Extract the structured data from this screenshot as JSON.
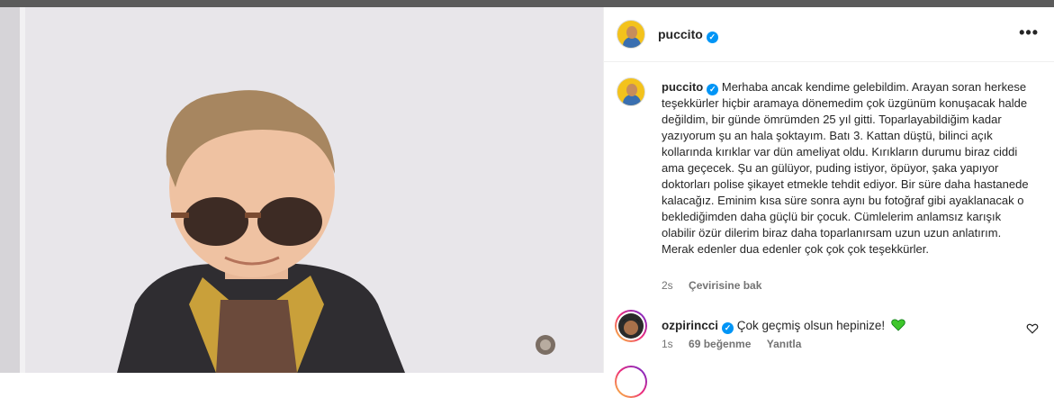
{
  "post": {
    "username": "puccito",
    "more_label": "•••"
  },
  "caption": {
    "username": "puccito",
    "text": "Merhaba ancak kendime gelebildim. Arayan soran herkese teşekkürler hiçbir aramaya dönemedim çok üzgünüm konuşacak halde değildim, bir günde ömrümden 25 yıl gitti. Toparlayabildiğim kadar yazıyorum şu an hala şoktayım. Batı 3. Kattan düştü, bilinci açık kollarında kırıklar var dün ameliyat oldu. Kırıkların durumu biraz ciddi ama geçecek. Şu an gülüyor, puding istiyor, öpüyor, şaka yapıyor doktorları polise şikayet etmekle tehdit ediyor. Bir süre daha hastanede kalacağız. Eminim kısa süre sonra aynı bu fotoğraf gibi ayaklanacak o beklediğimden daha güçlü bir çocuk. Cümlelerim anlamsız karışık olabilir özür dilerim biraz daha toparlanırsam uzun uzun anlatırım. Merak edenler dua edenler çok çok çok teşekkürler.",
    "time": "2s",
    "translate_label": "Çevirisine bak"
  },
  "comments": [
    {
      "username": "ozpirincci",
      "text": "Çok geçmiş olsun hepinize!",
      "time": "1s",
      "likes": "69 beğenme",
      "reply_label": "Yanıtla"
    }
  ],
  "colors": {
    "verified": "#0095f6",
    "text": "#262626",
    "muted": "#737373",
    "green_heart": "#3ec62b"
  }
}
